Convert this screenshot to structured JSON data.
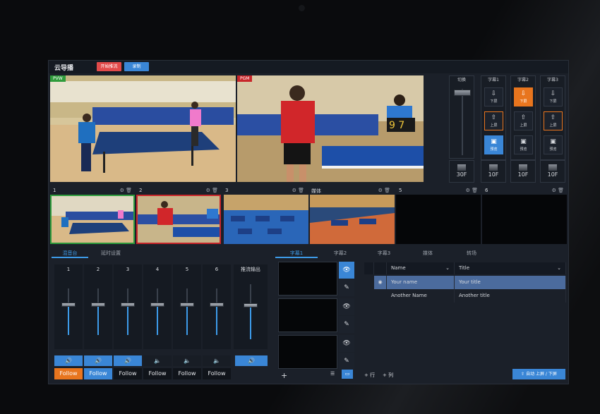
{
  "app": {
    "title": "云导播",
    "btn_stop": "开始推流",
    "btn_record": "录制"
  },
  "monitors": {
    "pvw_label": "PVW",
    "pgm_label": "PGM"
  },
  "controls": {
    "switch_label": "切换",
    "subs": [
      {
        "label": "字幕1",
        "down": "下屏",
        "up": "上屏",
        "preview": "预览"
      },
      {
        "label": "字幕2",
        "down": "下屏",
        "up": "上屏",
        "preview": "预览"
      },
      {
        "label": "字幕3",
        "down": "下屏",
        "up": "上屏",
        "preview": "预览"
      }
    ],
    "durations": [
      "30F",
      "10F",
      "10F",
      "10F"
    ]
  },
  "sources": [
    {
      "label": "1"
    },
    {
      "label": "2"
    },
    {
      "label": "3"
    },
    {
      "label": "媒体"
    },
    {
      "label": "5"
    },
    {
      "label": "6"
    }
  ],
  "mixer": {
    "tab_mixer": "混音台",
    "tab_delay": "延时设置",
    "channels": [
      {
        "num": "1",
        "follow": "Follow",
        "level": 0.3
      },
      {
        "num": "2",
        "follow": "Follow",
        "level": 0.3
      },
      {
        "num": "3",
        "follow": "Follow",
        "level": 0.3
      },
      {
        "num": "4",
        "follow": "Follow",
        "level": 0.3
      },
      {
        "num": "5",
        "follow": "Follow",
        "level": 0.3
      },
      {
        "num": "6",
        "follow": "Follow",
        "level": 0.3
      }
    ],
    "output_label": "推流输出",
    "output_level": 0.35
  },
  "subtitles": {
    "tabs": [
      "字幕1",
      "字幕2",
      "字幕3",
      "媒体",
      "转场"
    ],
    "col_name": "Name",
    "col_title": "Title",
    "rows": [
      {
        "name": "Your name",
        "title": "Your title"
      },
      {
        "name": "Another Name",
        "title": "Another title"
      }
    ],
    "add_row": "+ 行",
    "add_col": "+ 列",
    "auto_button": "自动 上屏 / 下屏",
    "add_plus": "+"
  },
  "colors": {
    "accent": "#3a86d6",
    "orange": "#e8751e",
    "red": "#e24a4a"
  }
}
